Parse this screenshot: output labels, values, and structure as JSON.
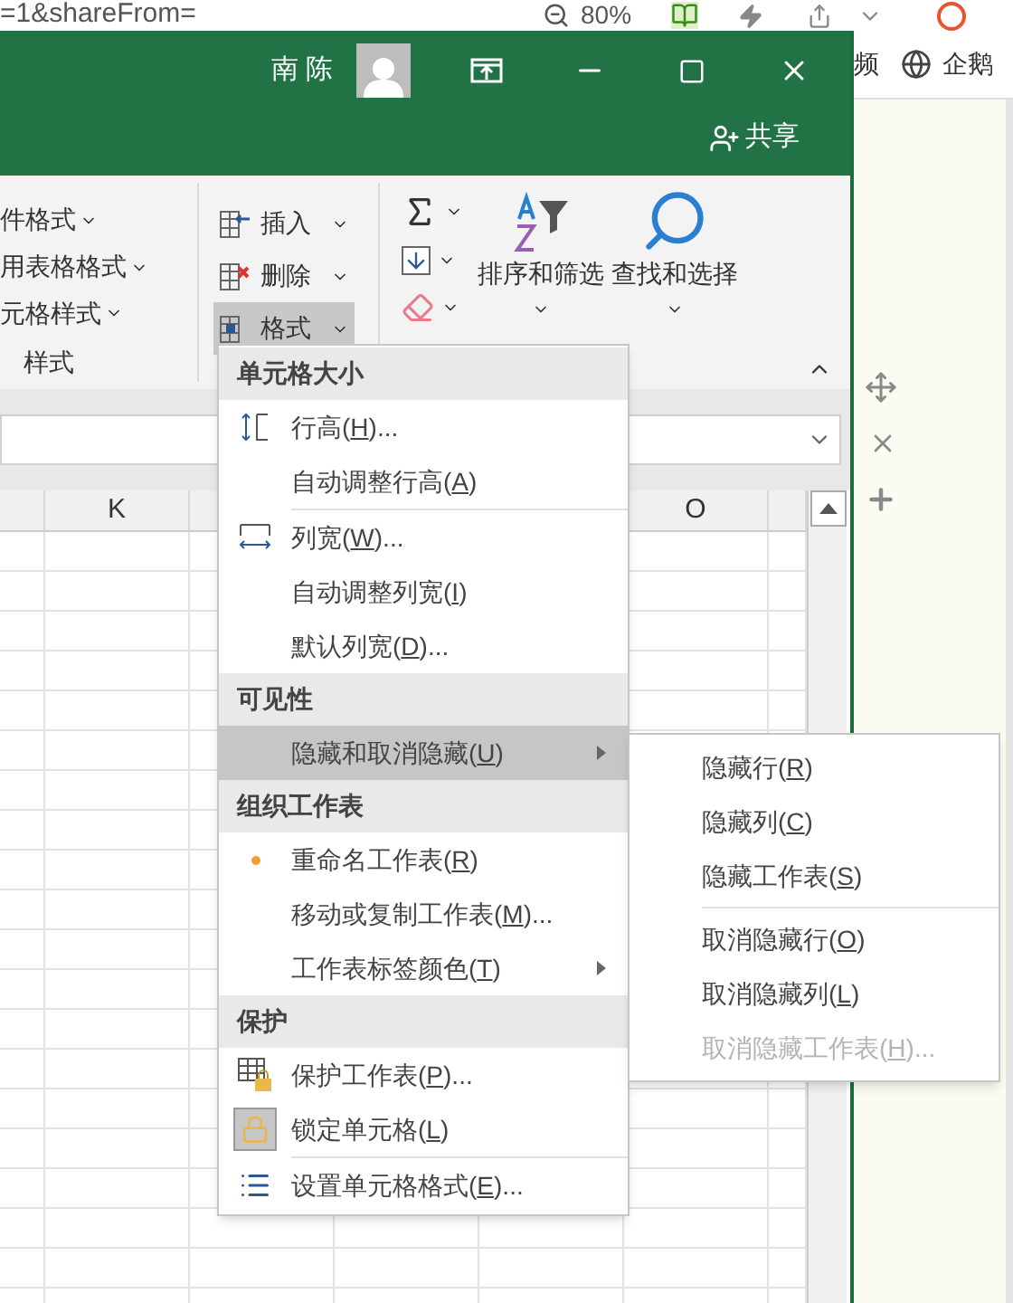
{
  "browser": {
    "address": "=1&shareFrom=",
    "zoom": "80%",
    "links": [
      "频",
      "企鹅"
    ]
  },
  "title_bar": {
    "user": "南 陈",
    "share": "共享"
  },
  "ribbon": {
    "styles": {
      "items": [
        "件格式",
        "用表格格式",
        "元格样式"
      ],
      "label": "样式"
    },
    "cells": [
      {
        "label": "插入",
        "selected": false
      },
      {
        "label": "删除",
        "selected": false
      },
      {
        "label": "格式",
        "selected": true
      }
    ],
    "editing": {
      "sort": "排序和筛选",
      "find": "查找和选择"
    }
  },
  "column_headers": [
    {
      "label": "K"
    },
    {
      "label": "O"
    }
  ],
  "format_menu": [
    {
      "kind": "header",
      "label": "单元格大小"
    },
    {
      "kind": "item",
      "before": "行高(",
      "key": "H",
      "after": ")...",
      "selected": false,
      "submenu": false
    },
    {
      "kind": "item",
      "before": "自动调整行高(",
      "key": "A",
      "after": ")",
      "selected": false,
      "submenu": false
    },
    {
      "kind": "separator"
    },
    {
      "kind": "item",
      "before": "列宽(",
      "key": "W",
      "after": ")...",
      "selected": false,
      "submenu": false
    },
    {
      "kind": "item",
      "before": "自动调整列宽(",
      "key": "I",
      "after": ")",
      "selected": false,
      "submenu": false
    },
    {
      "kind": "item",
      "before": "默认列宽(",
      "key": "D",
      "after": ")...",
      "selected": false,
      "submenu": false
    },
    {
      "kind": "header",
      "label": "可见性"
    },
    {
      "kind": "item",
      "before": "隐藏和取消隐藏(",
      "key": "U",
      "after": ")",
      "selected": true,
      "submenu": true
    },
    {
      "kind": "header",
      "label": "组织工作表"
    },
    {
      "kind": "item",
      "before": "重命名工作表(",
      "key": "R",
      "after": ")",
      "selected": false,
      "submenu": false
    },
    {
      "kind": "item",
      "before": "移动或复制工作表(",
      "key": "M",
      "after": ")...",
      "selected": false,
      "submenu": false
    },
    {
      "kind": "item",
      "before": "工作表标签颜色(",
      "key": "T",
      "after": ")",
      "selected": false,
      "submenu": true
    },
    {
      "kind": "header",
      "label": "保护"
    },
    {
      "kind": "item",
      "before": "保护工作表(",
      "key": "P",
      "after": ")...",
      "selected": false,
      "submenu": false
    },
    {
      "kind": "item",
      "before": "锁定单元格(",
      "key": "L",
      "after": ")",
      "selected": false,
      "submenu": false
    },
    {
      "kind": "separator"
    },
    {
      "kind": "item",
      "before": "设置单元格格式(",
      "key": "E",
      "after": ")...",
      "selected": false,
      "submenu": false
    }
  ],
  "hide_submenu": [
    {
      "kind": "item",
      "before": "隐藏行(",
      "key": "R",
      "after": ")",
      "disabled": false
    },
    {
      "kind": "item",
      "before": "隐藏列(",
      "key": "C",
      "after": ")",
      "disabled": false
    },
    {
      "kind": "item",
      "before": "隐藏工作表(",
      "key": "S",
      "after": ")",
      "disabled": false
    },
    {
      "kind": "separator"
    },
    {
      "kind": "item",
      "before": "取消隐藏行(",
      "key": "O",
      "after": ")",
      "disabled": false
    },
    {
      "kind": "item",
      "before": "取消隐藏列(",
      "key": "L",
      "after": ")",
      "disabled": false
    },
    {
      "kind": "item",
      "before": "取消隐藏工作表(",
      "key": "H",
      "after": ")...",
      "disabled": true
    }
  ]
}
